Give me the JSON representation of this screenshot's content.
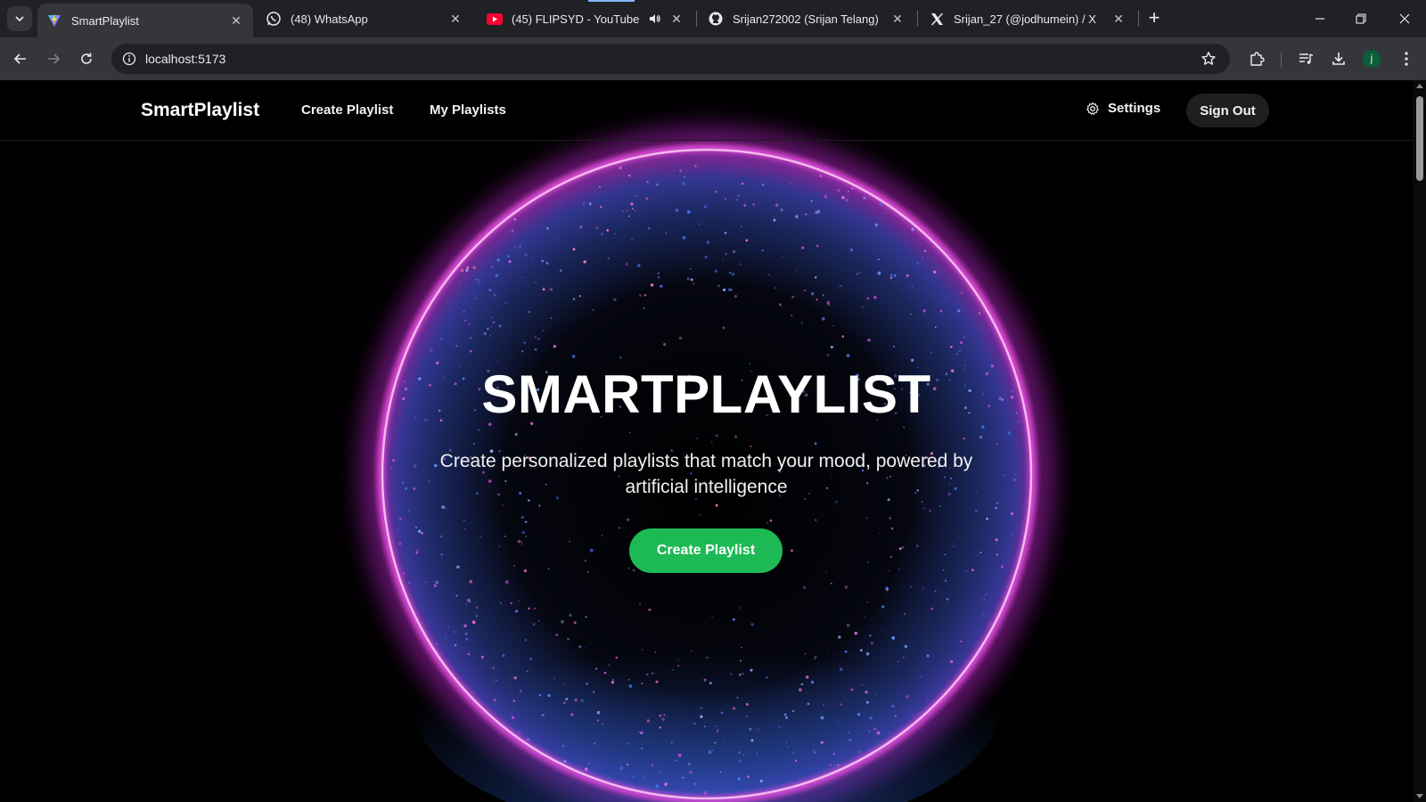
{
  "browser": {
    "tabs": [
      {
        "title": "SmartPlaylist",
        "active": true,
        "favicon": "vite-icon"
      },
      {
        "title": "(48) WhatsApp",
        "active": false,
        "favicon": "whatsapp-icon"
      },
      {
        "title": "(45) FLIPSYD - YouTube",
        "active": false,
        "favicon": "youtube-icon",
        "audio": true
      },
      {
        "title": "Srijan272002 (Srijan Telang)",
        "active": false,
        "favicon": "github-icon"
      },
      {
        "title": "Srijan_27 (@jodhumein) / X",
        "active": false,
        "favicon": "x-icon"
      }
    ],
    "url": "localhost:5173",
    "profile_initial": "j"
  },
  "app": {
    "brand": "SmartPlaylist",
    "nav": {
      "create_playlist": "Create Playlist",
      "my_playlists": "My Playlists",
      "settings": "Settings",
      "sign_out": "Sign Out"
    },
    "hero": {
      "title": "SMARTPLAYLIST",
      "subtitle": "Create personalized playlists that match your mood, powered by artificial intelligence",
      "cta": "Create Playlist"
    },
    "colors": {
      "accent": "#1db954",
      "orb_ring": "#d946c8",
      "orb_particles": "#3b6fd8",
      "background": "#000000"
    }
  }
}
